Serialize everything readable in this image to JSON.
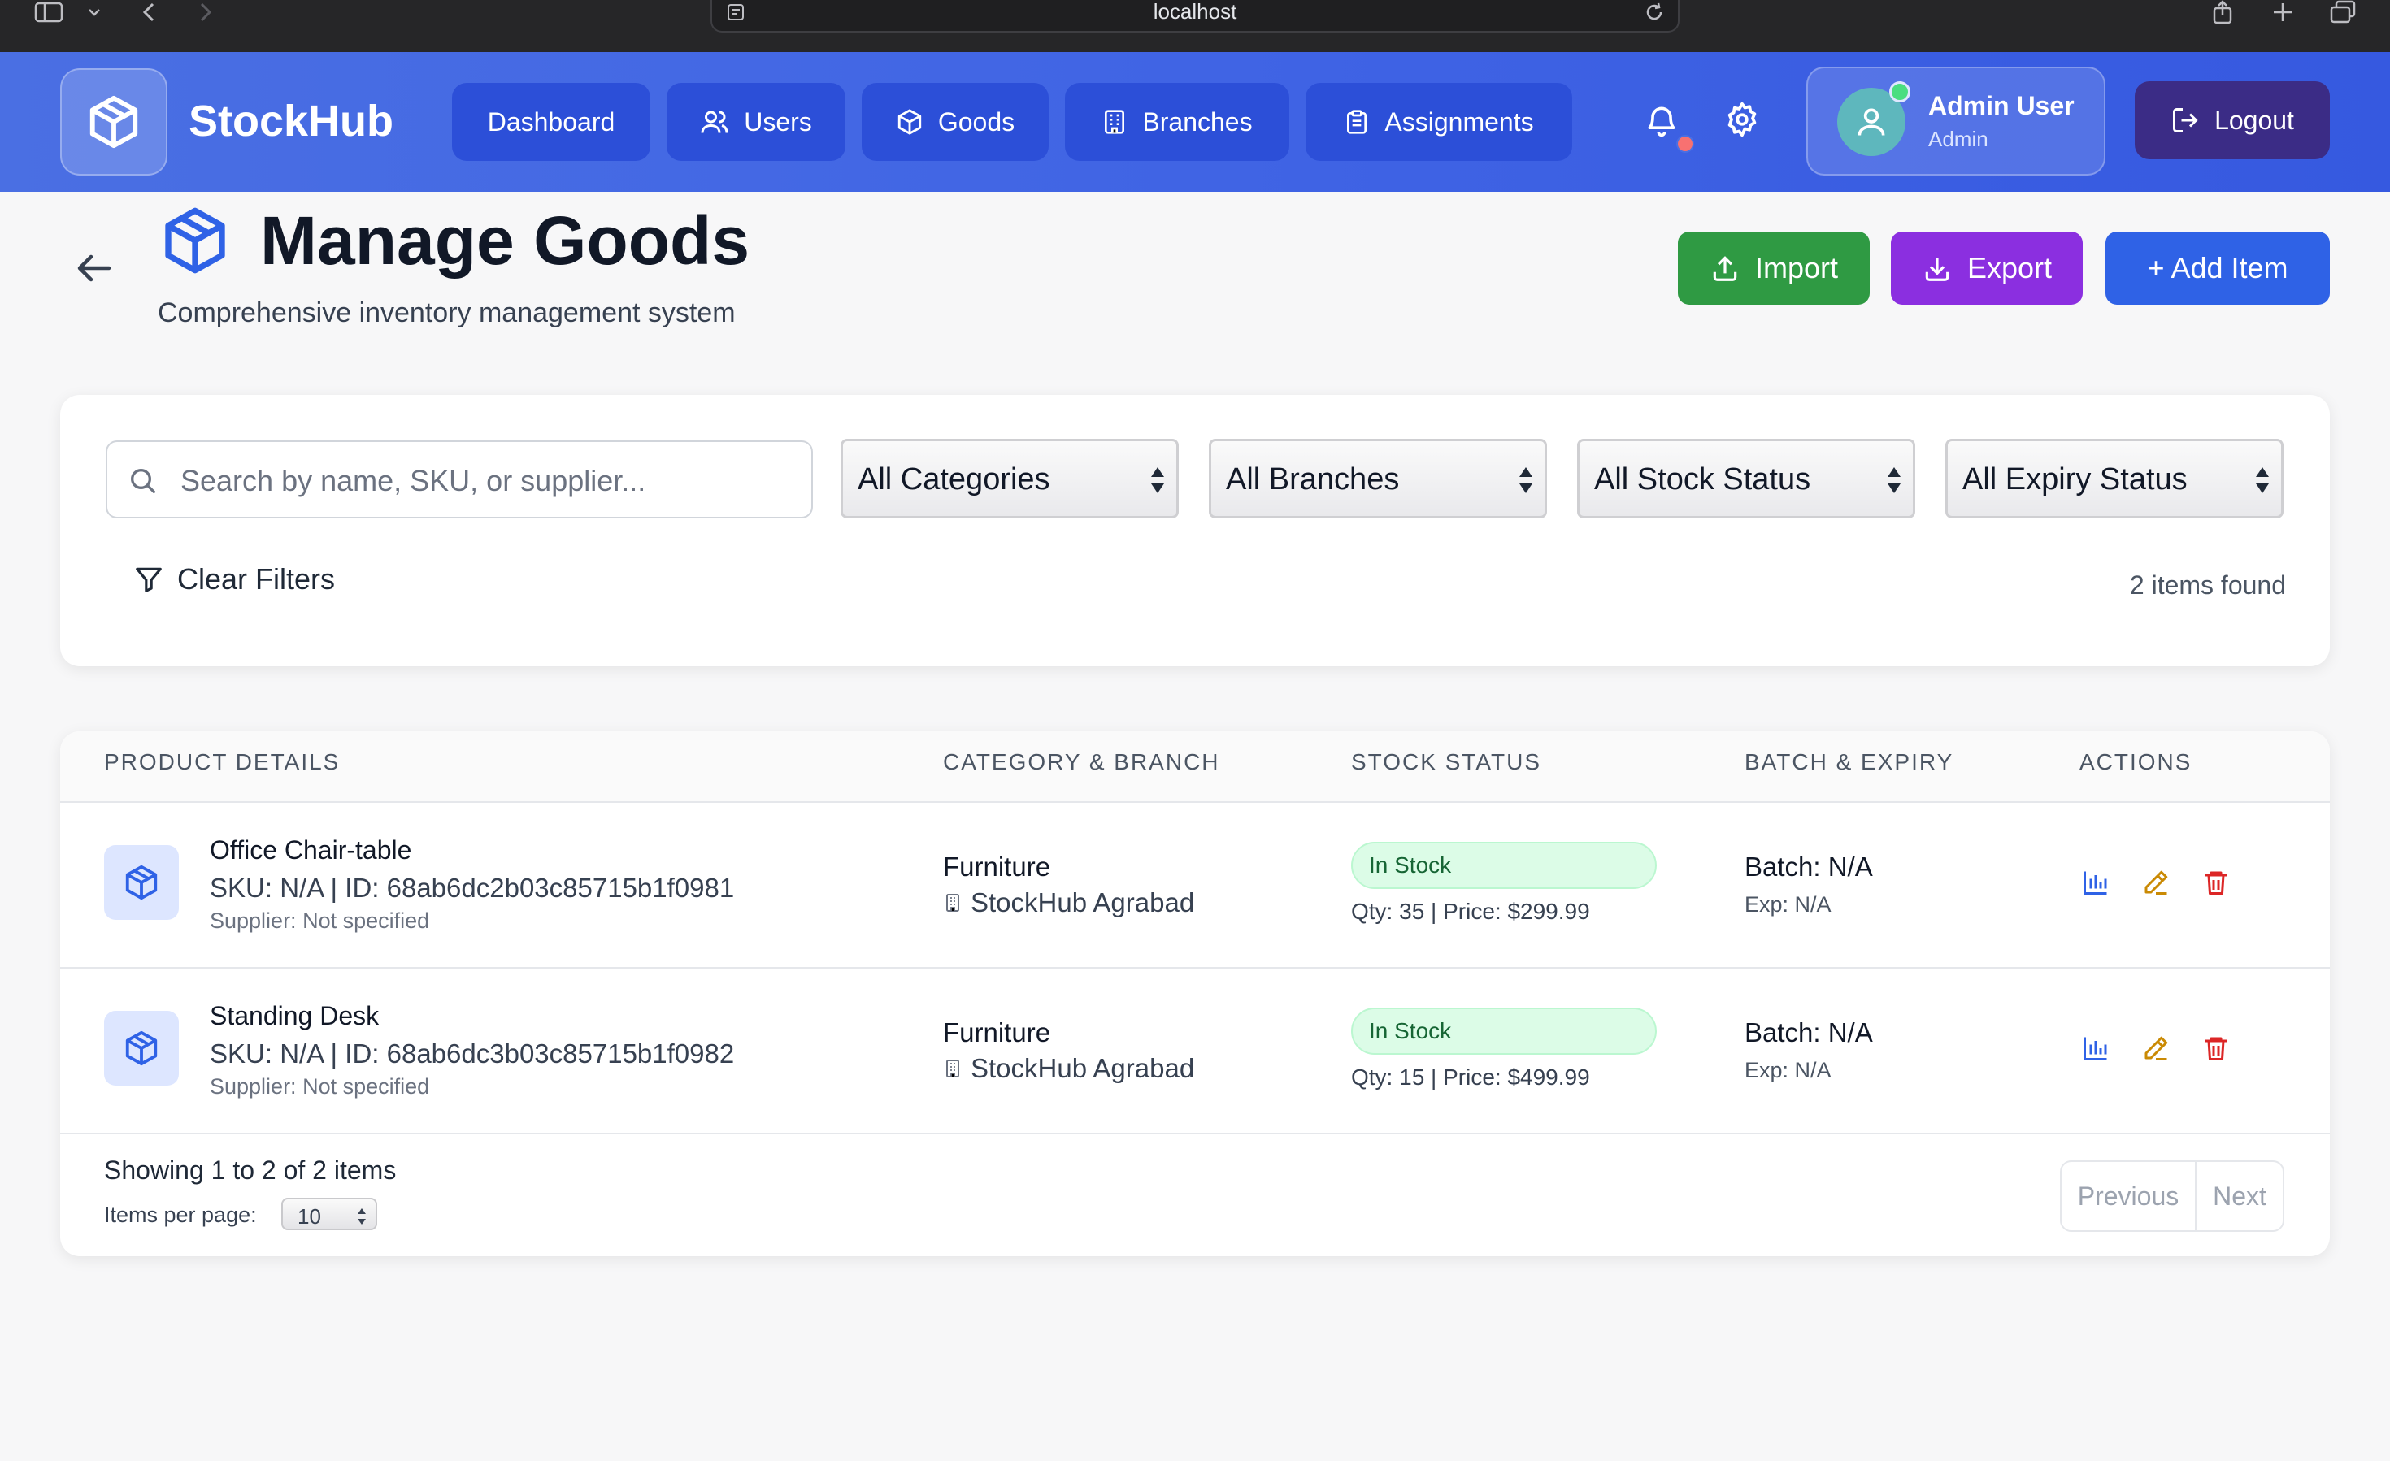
{
  "browser": {
    "url": "localhost"
  },
  "header": {
    "brand": "StockHub",
    "nav": [
      {
        "label": "Dashboard",
        "icon": "dashboard"
      },
      {
        "label": "Users",
        "icon": "users-icon"
      },
      {
        "label": "Goods",
        "icon": "box-icon"
      },
      {
        "label": "Branches",
        "icon": "building-icon"
      },
      {
        "label": "Assignments",
        "icon": "clipboard-icon"
      }
    ],
    "user": {
      "name": "Admin User",
      "role": "Admin"
    },
    "logout_label": "Logout"
  },
  "page": {
    "title": "Manage Goods",
    "subtitle": "Comprehensive inventory management system",
    "actions": {
      "import": "Import",
      "export": "Export",
      "add": "+ Add Item"
    }
  },
  "filters": {
    "search_placeholder": "Search by name, SKU, or supplier...",
    "category": "All Categories",
    "branch": "All Branches",
    "stock_status": "All Stock Status",
    "expiry_status": "All Expiry Status",
    "clear_label": "Clear Filters",
    "items_found": "2 items found"
  },
  "table": {
    "headers": [
      "PRODUCT DETAILS",
      "CATEGORY & BRANCH",
      "STOCK STATUS",
      "BATCH & EXPIRY",
      "ACTIONS"
    ],
    "rows": [
      {
        "name": "Office Chair-table",
        "sku": "SKU: N/A | ID: 68ab6dc2b03c85715b1f0981",
        "supplier": "Supplier: Not specified",
        "category": "Furniture",
        "branch": "StockHub Agrabad",
        "status": "In Stock",
        "qty_price": "Qty: 35 | Price: $299.99",
        "batch": "Batch: N/A",
        "exp": "Exp: N/A"
      },
      {
        "name": "Standing Desk",
        "sku": "SKU: N/A | ID: 68ab6dc3b03c85715b1f0982",
        "supplier": "Supplier: Not specified",
        "category": "Furniture",
        "branch": "StockHub Agrabad",
        "status": "In Stock",
        "qty_price": "Qty: 15 | Price: $499.99",
        "batch": "Batch: N/A",
        "exp": "Exp: N/A"
      }
    ]
  },
  "pagination": {
    "showing": "Showing 1 to 2 of 2 items",
    "per_page_label": "Items per page:",
    "per_page_value": "10",
    "previous": "Previous",
    "next": "Next"
  },
  "colors": {
    "header": "#3f63e4",
    "nav_button": "#2c4fd8",
    "import": "#2f9a43",
    "export": "#8b2fe0",
    "add": "#2f62e6",
    "in_stock": "#dcfce7"
  }
}
